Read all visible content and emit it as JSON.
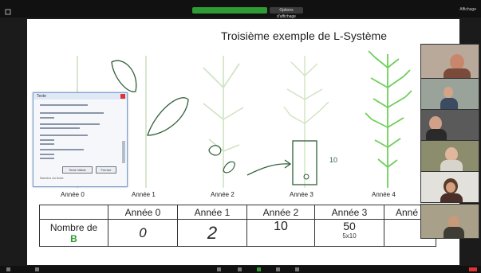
{
  "app": {
    "sharing_banner": "",
    "view_option": "Options d'affichage",
    "top_right": "Affichage"
  },
  "board": {
    "title": "Troisième exemple de L-Système",
    "year_labels": [
      "Année 0",
      "Année 1",
      "Année 2",
      "Année 3",
      "Année 4"
    ],
    "annotation_10": "10"
  },
  "table": {
    "headers": [
      "",
      "Année 0",
      "Année 1",
      "Année 2",
      "Année 3",
      "Anné"
    ],
    "row_label_line1": "Nombre de",
    "row_label_line2": "B",
    "values": [
      "0",
      "2",
      "10",
      "50",
      ""
    ],
    "subnote": "5x10"
  },
  "dialog": {
    "title": "Texte",
    "ok": "Texte Valide",
    "cancel": "Fermer",
    "footer": "Numéro du texte"
  },
  "colors": {
    "sharing_green": "#2e9b34",
    "plant_green": "#6fcf5a",
    "pale_green": "#cfe3c2",
    "ink": "#2f5f3a"
  },
  "icons": [
    "window-icon",
    "participants-icon",
    "mic-icon",
    "camera-icon",
    "share-icon",
    "chat-icon",
    "leave-icon"
  ]
}
